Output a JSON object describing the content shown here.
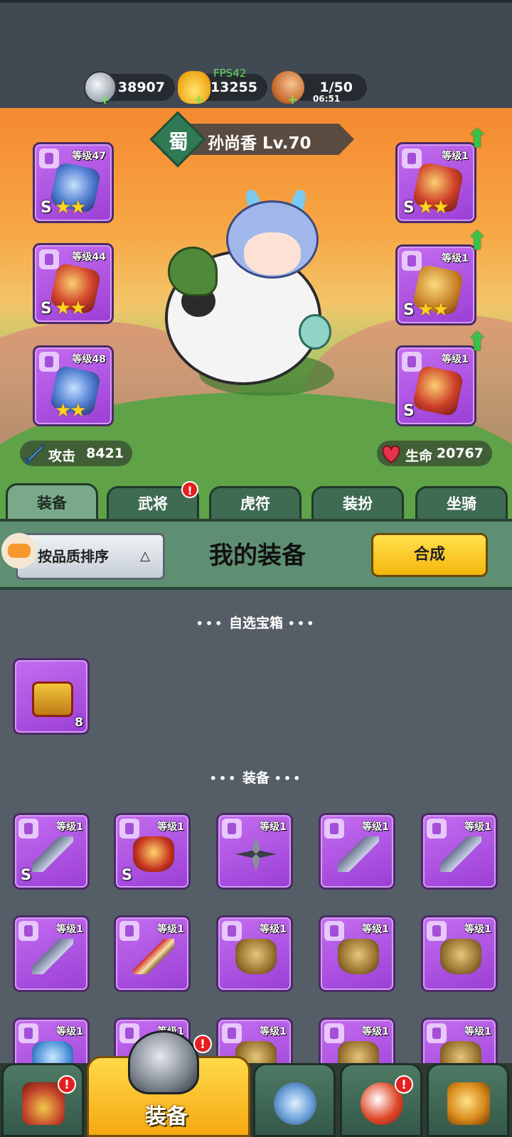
{
  "resources": {
    "silver": "38907",
    "gold": "13255",
    "stamina": "1/50",
    "stamina_timer": "06:51",
    "fps": "FPS42"
  },
  "hero": {
    "faction": "蜀",
    "name": "孙尚香 Lv.70",
    "attack_label": "攻击",
    "attack_value": "8421",
    "hp_label": "生命",
    "hp_value": "20767"
  },
  "equipped": {
    "left": [
      {
        "level": "等级47",
        "grade": "S",
        "stars": "★★"
      },
      {
        "level": "等级44",
        "grade": "S",
        "stars": "★★"
      },
      {
        "level": "等级48",
        "grade": "",
        "stars": "★★"
      }
    ],
    "right": [
      {
        "level": "等级1",
        "grade": "S",
        "stars": "★★"
      },
      {
        "level": "等级1",
        "grade": "S",
        "stars": "★★"
      },
      {
        "level": "等级1",
        "grade": "S",
        "stars": ""
      }
    ]
  },
  "tabs": [
    {
      "label": "装备"
    },
    {
      "label": "武将",
      "badge": "!"
    },
    {
      "label": "虎符"
    },
    {
      "label": "装扮"
    },
    {
      "label": "坐骑"
    }
  ],
  "panel": {
    "sort_label": "按品质排序",
    "sort_arrow": "△",
    "title": "我的装备",
    "merge_label": "合成"
  },
  "sections": {
    "chest_title": "自选宝箱",
    "equip_title": "装备",
    "dots_left": "•••",
    "dots_right": "•••"
  },
  "chest_item": {
    "count": "8"
  },
  "inventory": [
    {
      "level": "等级1",
      "grade": "S",
      "art": "blade"
    },
    {
      "level": "等级1",
      "grade": "S",
      "art": "armor-red"
    },
    {
      "level": "等级1",
      "grade": "",
      "art": "shuriken"
    },
    {
      "level": "等级1",
      "grade": "",
      "art": "blade"
    },
    {
      "level": "等级1",
      "grade": "",
      "art": "blade"
    },
    {
      "level": "等级1",
      "grade": "",
      "art": "blade"
    },
    {
      "level": "等级1",
      "grade": "",
      "art": "weapon"
    },
    {
      "level": "等级1",
      "grade": "",
      "art": "armor"
    },
    {
      "level": "等级1",
      "grade": "",
      "art": "armor"
    },
    {
      "level": "等级1",
      "grade": "",
      "art": "armor"
    },
    {
      "level": "等级1",
      "grade": "",
      "art": "blue"
    },
    {
      "level": "等级1",
      "grade": "",
      "art": "armor"
    },
    {
      "level": "等级1",
      "grade": "",
      "art": "armor"
    },
    {
      "level": "等级1",
      "grade": "",
      "art": "armor"
    },
    {
      "level": "等级1",
      "grade": "",
      "art": "armor"
    }
  ],
  "bottom_nav": {
    "active_label": "装备",
    "alert": "!"
  },
  "colors": {
    "purple_slot": "#b556e8",
    "tab_green": "#3e6b52",
    "merge_yellow": "#f5c21a",
    "alert_red": "#e32020"
  }
}
